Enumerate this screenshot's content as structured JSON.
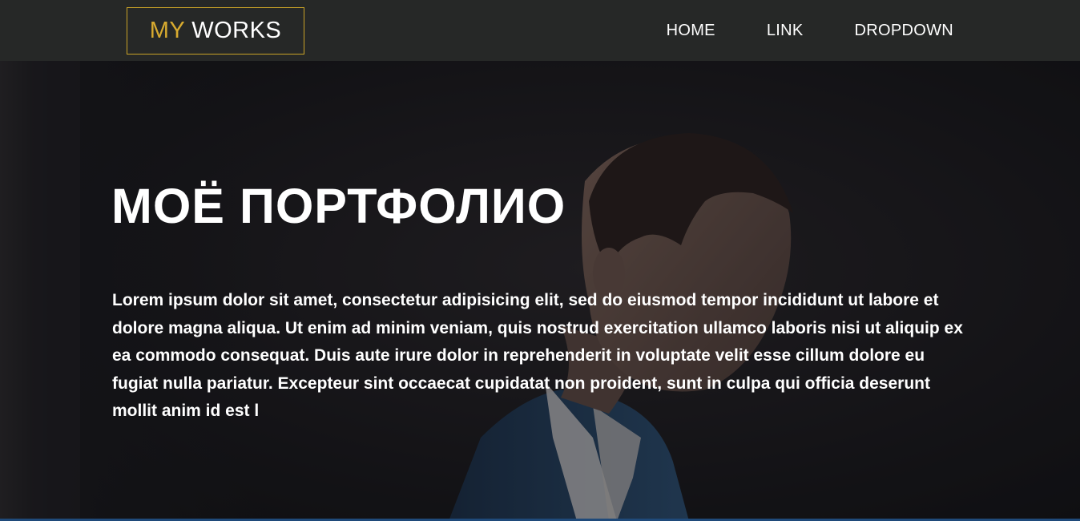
{
  "navbar": {
    "brand_accent": "MY",
    "brand_main": "WORKS",
    "links": [
      "HOME",
      "LINK",
      "DROPDOWN"
    ]
  },
  "hero": {
    "title": "МОЁ ПОРТФОЛИО",
    "text": "Lorem ipsum dolor sit amet, consectetur adipisicing elit, sed do eiusmod tempor incididunt ut labore et dolore magna aliqua. Ut enim ad minim veniam, quis nostrud exercitation ullamco laboris nisi ut aliquip ex ea commodo consequat. Duis aute irure dolor in reprehenderit in voluptate velit esse cillum dolore eu fugiat nulla pariatur. Excepteur sint occaecat cupidatat non proident, sunt in culpa qui officia deserunt mollit anim id est l"
  },
  "colors": {
    "navbar_bg": "#262827",
    "brand_accent": "#d8ab2f",
    "brand_border": "#c9a227",
    "text": "#ffffff",
    "hero_bg": "#19191c"
  }
}
